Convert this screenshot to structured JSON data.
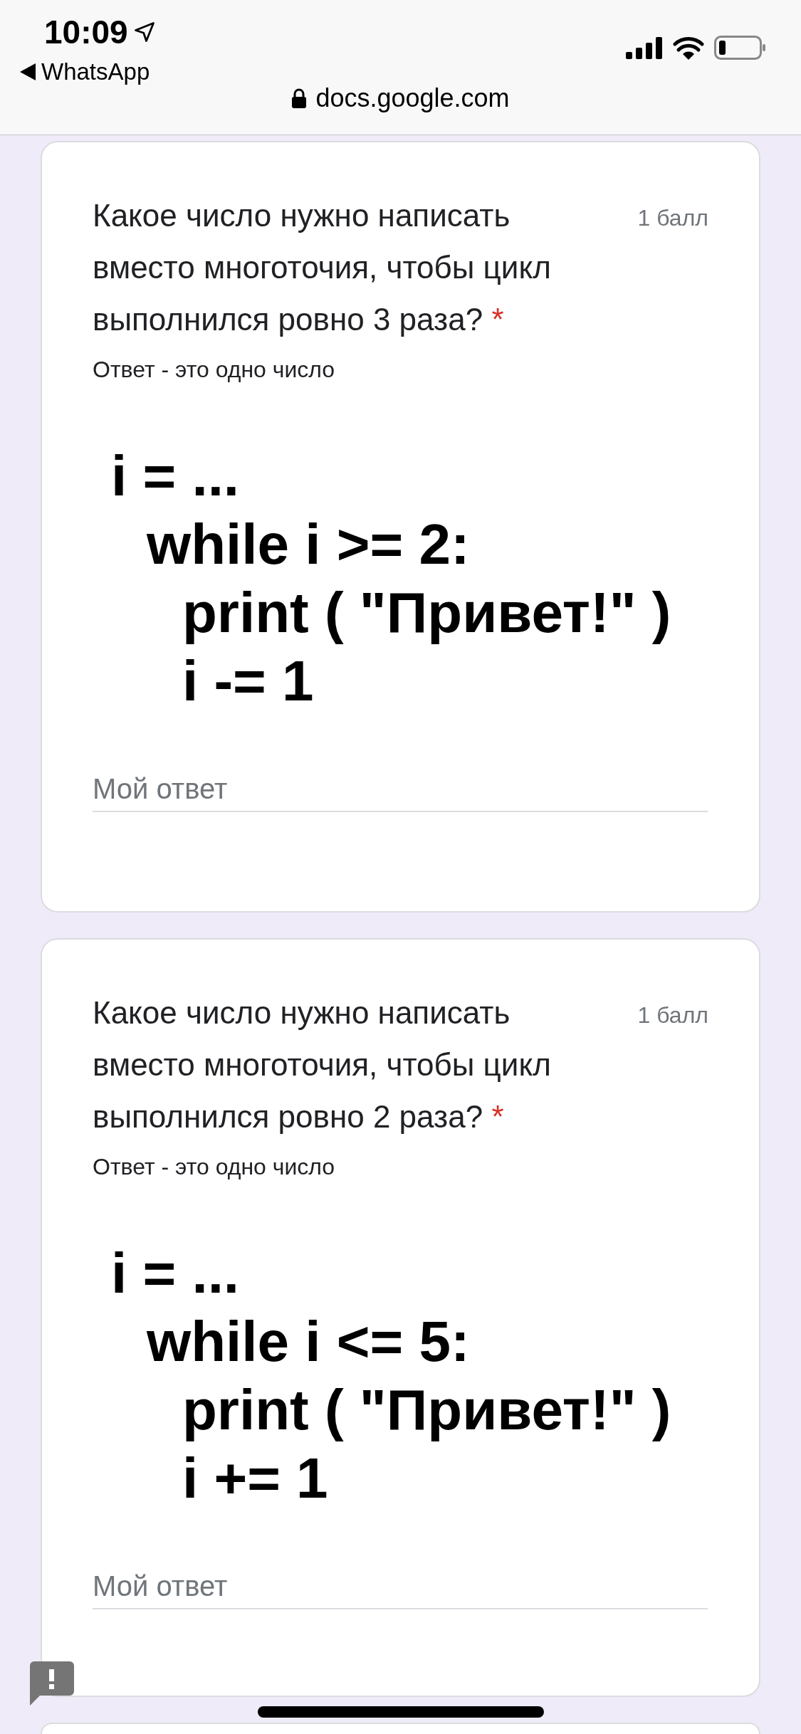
{
  "status_bar": {
    "time": "10:09",
    "back_app": "WhatsApp",
    "url": "docs.google.com"
  },
  "questions": [
    {
      "text": "Какое число нужно написать вместо многоточия, чтобы цикл выполнился ровно 3 раза?",
      "required_mark": "*",
      "points": "1 балл",
      "hint": "Ответ - это одно число",
      "code": [
        {
          "text": "i = ...",
          "children": [
            {
              "text": "while i >= 2:",
              "children": [
                {
                  "text": "print ( \"Привет!\" )"
                },
                {
                  "text": "i -= 1"
                }
              ]
            }
          ]
        }
      ],
      "answer": {
        "placeholder": "Мой ответ"
      }
    },
    {
      "text": "Какое число нужно написать вместо многоточия, чтобы цикл выполнился ровно 2 раза?",
      "required_mark": "*",
      "points": "1 балл",
      "hint": "Ответ - это одно число",
      "code": [
        {
          "text": "i = ...",
          "children": [
            {
              "text": "while i <= 5:",
              "children": [
                {
                  "text": "print ( \"Привет!\" )"
                },
                {
                  "text": "i += 1"
                }
              ]
            }
          ]
        }
      ],
      "answer": {
        "placeholder": "Мой ответ"
      }
    }
  ]
}
